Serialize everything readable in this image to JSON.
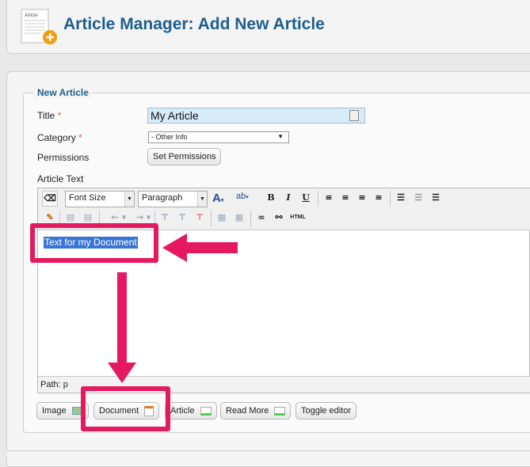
{
  "header": {
    "title": "Article Manager: Add New Article",
    "icon": "article-add-icon"
  },
  "form": {
    "legend": "New Article",
    "title_label": "Title",
    "title_value": "My Article",
    "required_mark": "*",
    "category_label": "Category",
    "category_value": "- Other Info",
    "permissions_label": "Permissions",
    "permissions_button": "Set Permissions",
    "article_text_label": "Article Text"
  },
  "toolbar": {
    "font_size": "Font Size",
    "format": "Paragraph",
    "bold": "B",
    "italic": "I",
    "underline": "U",
    "html": "HTML"
  },
  "editor": {
    "content": "Text for my Document",
    "path": "Path: p"
  },
  "buttons": {
    "image": "Image",
    "document": "Document",
    "article": "Article",
    "read_more": "Read More",
    "toggle_editor": "Toggle editor"
  },
  "colors": {
    "title_blue": "#1f5e8c",
    "highlight_pink": "#e5195f",
    "selection_blue": "#3875d7",
    "required_orange": "#e0693a"
  }
}
